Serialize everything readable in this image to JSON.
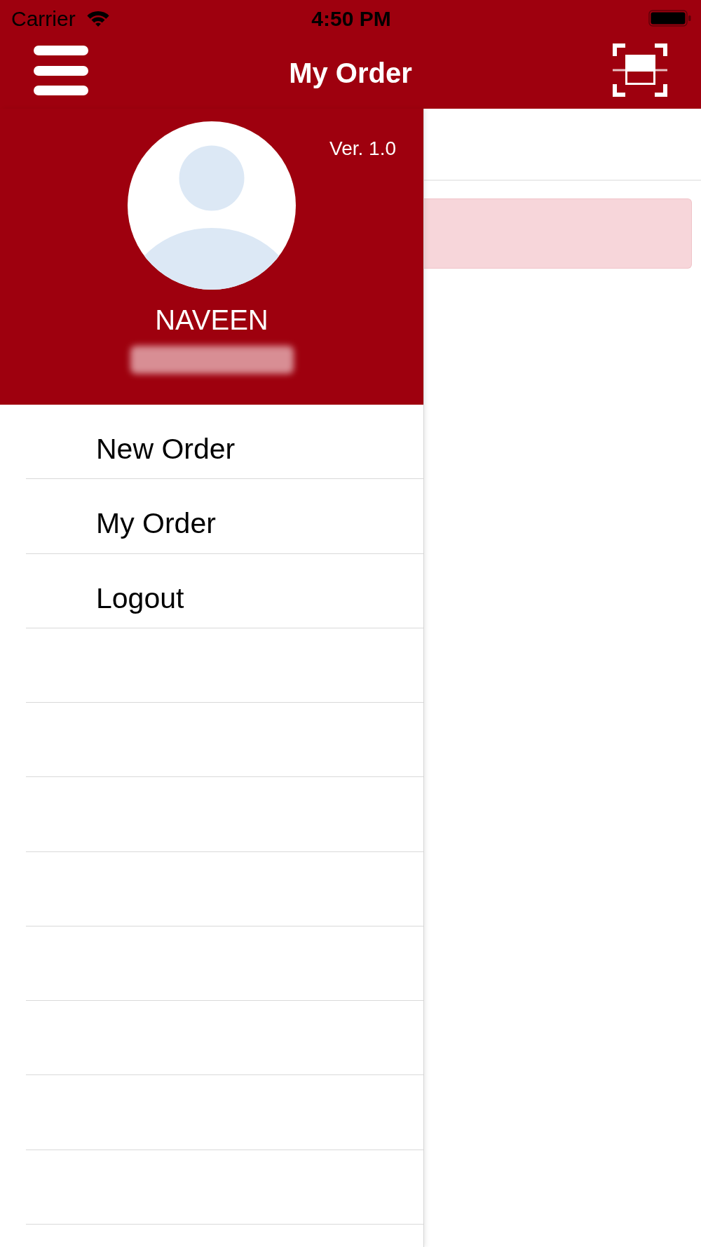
{
  "status_bar": {
    "carrier": "Carrier",
    "time": "4:50 PM"
  },
  "header": {
    "title": "My Order"
  },
  "drawer": {
    "version": "Ver. 1.0",
    "user_name": "NAVEEN",
    "menu": [
      {
        "label": "New Order"
      },
      {
        "label": "My Order"
      },
      {
        "label": "Logout"
      }
    ]
  },
  "content": {
    "alert": {
      "kind": "danger"
    }
  }
}
